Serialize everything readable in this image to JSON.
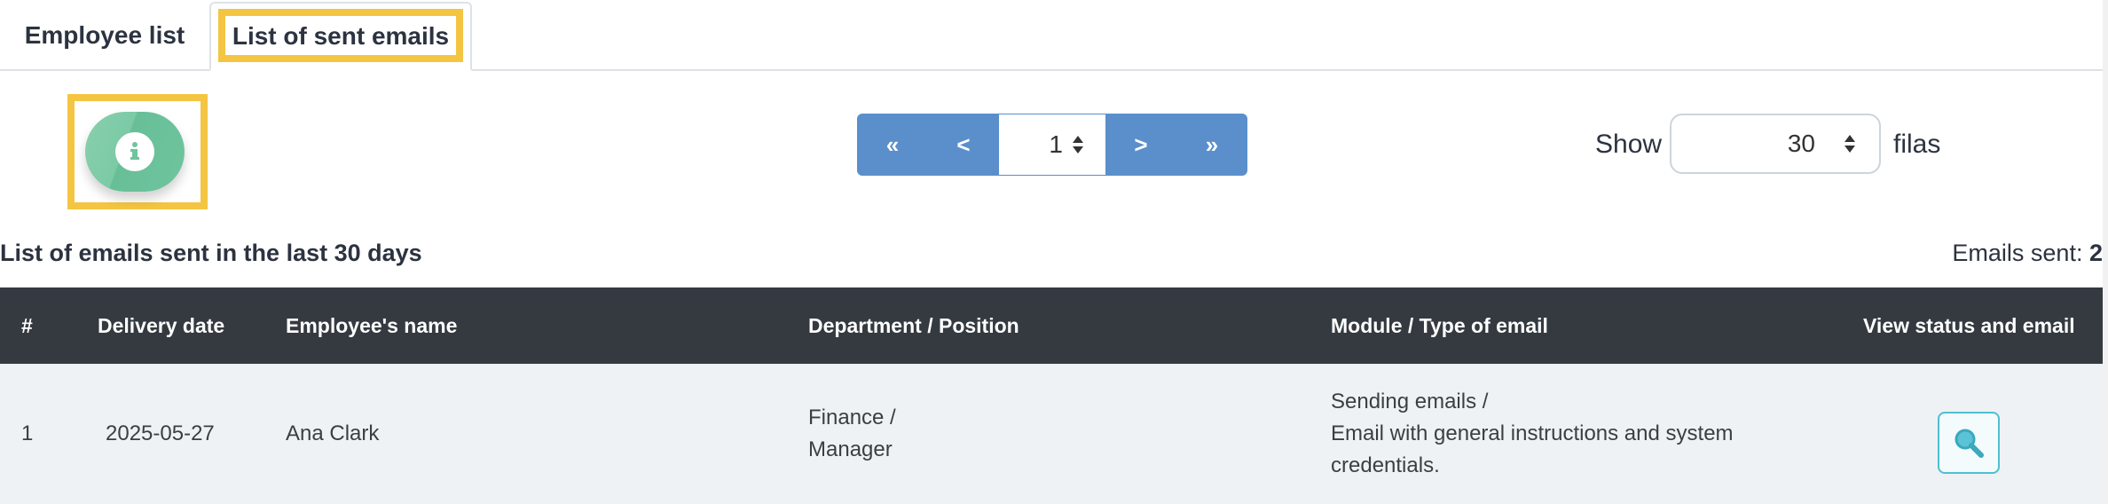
{
  "tabs": [
    {
      "label": "Employee list"
    },
    {
      "label": "List of sent emails"
    }
  ],
  "pagination": {
    "first_label": "«",
    "prev_label": "<",
    "page_value": "1",
    "next_label": ">",
    "last_label": "»"
  },
  "rows_per_page": {
    "show_label": "Show",
    "value": "30",
    "suffix_label": "filas"
  },
  "list": {
    "title": "List of emails sent in the last 30 days",
    "count_label": "Emails sent:",
    "count_value": "2"
  },
  "table": {
    "headers": [
      "#",
      "Delivery date",
      "Employee's name",
      "Department / Position",
      "Module / Type of email",
      "View status and email"
    ],
    "rows": [
      {
        "num": "1",
        "date": "2025-05-27",
        "name": "Ana Clark",
        "dept_line1": "Finance /",
        "dept_line2": "Manager",
        "module_line1": "Sending emails /",
        "module_line2": "Email with general instructions and system",
        "module_line3": "credentials."
      }
    ]
  },
  "icons": {
    "info": "info-icon",
    "view": "search-icon",
    "spinner": "sort-arrows-icon"
  },
  "colors": {
    "highlight": "#f4c542",
    "pager": "#5a8fcb",
    "info_button": "#6fc49d",
    "table_header": "#343a40",
    "view_button_border": "#4fbfd0"
  }
}
